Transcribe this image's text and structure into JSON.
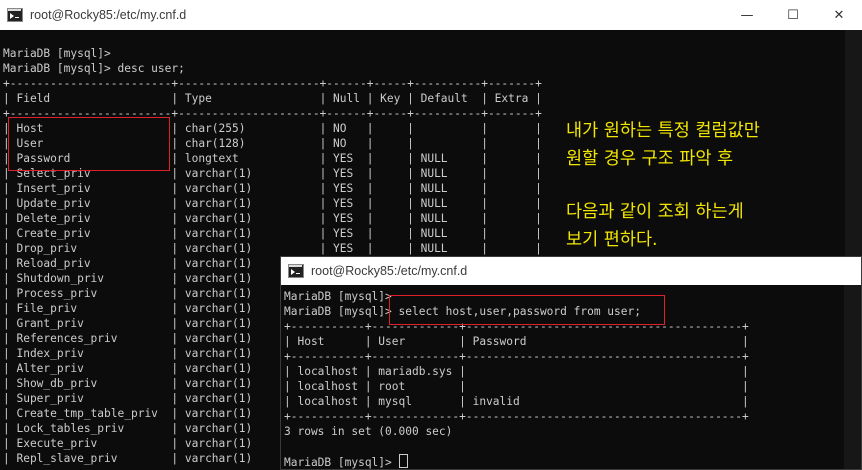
{
  "window1": {
    "title": "root@Rocky85:/etc/my.cnf.d",
    "controls": {
      "minimize": "—",
      "maximize": "☐",
      "close": "✕"
    },
    "lines": [
      "MariaDB [mysql]>",
      "MariaDB [mysql]> desc user;",
      "+------------------------+---------------------+------+-----+----------+-------+",
      "| Field                  | Type                | Null | Key | Default  | Extra |",
      "+------------------------+---------------------+------+-----+----------+-------+",
      "| Host                   | char(255)           | NO   |     |          |       |",
      "| User                   | char(128)           | NO   |     |          |       |",
      "| Password               | longtext            | YES  |     | NULL     |       |",
      "| Select_priv            | varchar(1)          | YES  |     | NULL     |       |",
      "| Insert_priv            | varchar(1)          | YES  |     | NULL     |       |",
      "| Update_priv            | varchar(1)          | YES  |     | NULL     |       |",
      "| Delete_priv            | varchar(1)          | YES  |     | NULL     |       |",
      "| Create_priv            | varchar(1)          | YES  |     | NULL     |       |",
      "| Drop_priv              | varchar(1)          | YES  |     | NULL     |       |",
      "| Reload_priv            | varchar(1)          |",
      "| Shutdown_priv          | varchar(1)          |",
      "| Process_priv           | varchar(1)          |",
      "| File_priv              | varchar(1)          |",
      "| Grant_priv             | varchar(1)          |",
      "| References_priv        | varchar(1)          |",
      "| Index_priv             | varchar(1)          |",
      "| Alter_priv             | varchar(1)          |",
      "| Show_db_priv           | varchar(1)          |",
      "| Super_priv             | varchar(1)          |",
      "| Create_tmp_table_priv  | varchar(1)          |",
      "| Lock_tables_priv       | varchar(1)          |",
      "| Execute_priv           | varchar(1)          |",
      "| Repl_slave_priv        | varchar(1)          |"
    ]
  },
  "annotation": {
    "line1": "내가 원하는 특정 컬럼값만",
    "line2": "원할 경우 구조 파악 후",
    "line3": "다음과 같이 조회 하는게",
    "line4": "보기 편하다."
  },
  "window2": {
    "title": "root@Rocky85:/etc/my.cnf.d",
    "lines": [
      "MariaDB [mysql]>",
      "MariaDB [mysql]> select host,user,password from user;",
      "+-----------+-------------+-----------------------------------------+",
      "| Host      | User        | Password                                |",
      "+-----------+-------------+-----------------------------------------+",
      "| localhost | mariadb.sys |                                         |",
      "| localhost | root        |                                         |",
      "| localhost | mysql       | invalid                                 |",
      "+-----------+-------------+-----------------------------------------+",
      "3 rows in set (0.000 sec)",
      "",
      "MariaDB [mysql]> "
    ]
  }
}
